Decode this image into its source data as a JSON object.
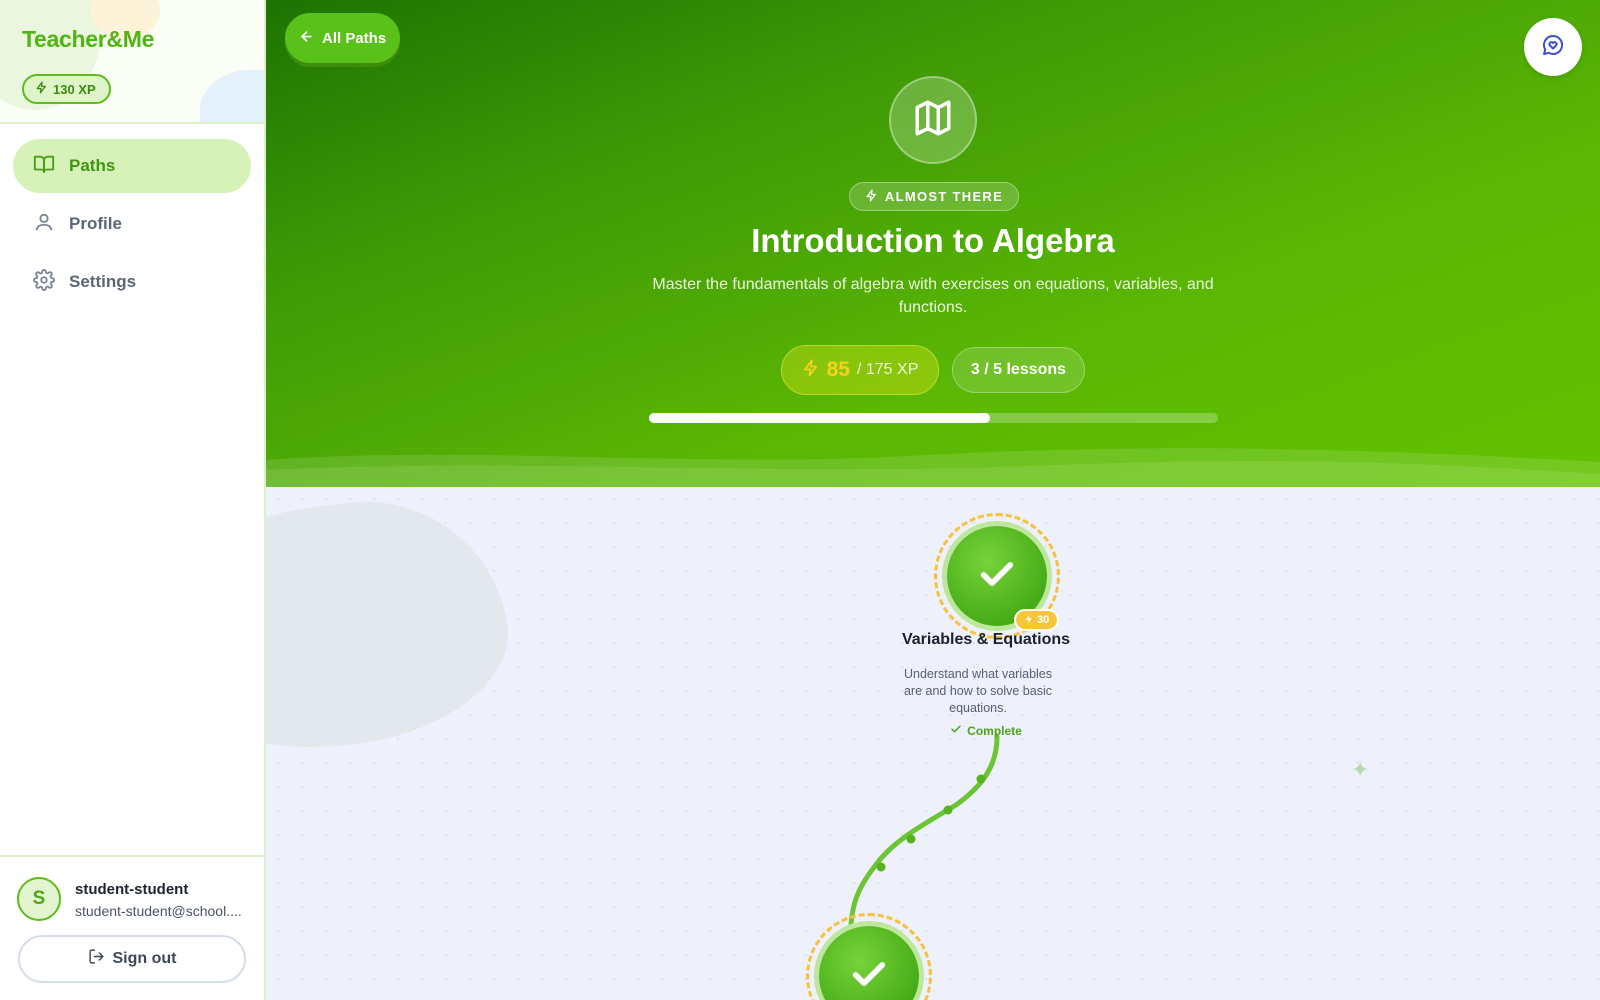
{
  "app": {
    "brand": "Teacher&Me",
    "xp_badge": "130 XP"
  },
  "sidebar": {
    "items": [
      {
        "label": "Paths",
        "icon": "book-open-icon",
        "active": true
      },
      {
        "label": "Profile",
        "icon": "user-icon",
        "active": false
      },
      {
        "label": "Settings",
        "icon": "gear-icon",
        "active": false
      }
    ]
  },
  "user": {
    "initial": "S",
    "name": "student-student",
    "email": "student-student@school....",
    "signout_label": "Sign out"
  },
  "header": {
    "back_label": "All Paths",
    "chat_icon": "chat-heart-icon"
  },
  "path": {
    "icon": "map-icon",
    "status": "ALMOST THERE",
    "title": "Introduction to Algebra",
    "description": "Master the fundamentals of algebra with exercises on equations, variables, and functions.",
    "xp_earned": "85",
    "xp_total": "/ 175 XP",
    "lessons": "3 / 5 lessons",
    "progress_fraction": 0.6
  },
  "lessons": [
    {
      "title": "Variables & Equations",
      "description": "Understand what variables are and how to solve basic equations.",
      "xp": "30",
      "status": "Complete"
    }
  ],
  "colors": {
    "brand": "#4fb512",
    "accent_gold": "#f8c53a",
    "hero_dark": "#1d7302",
    "hero_light": "#62c200"
  }
}
